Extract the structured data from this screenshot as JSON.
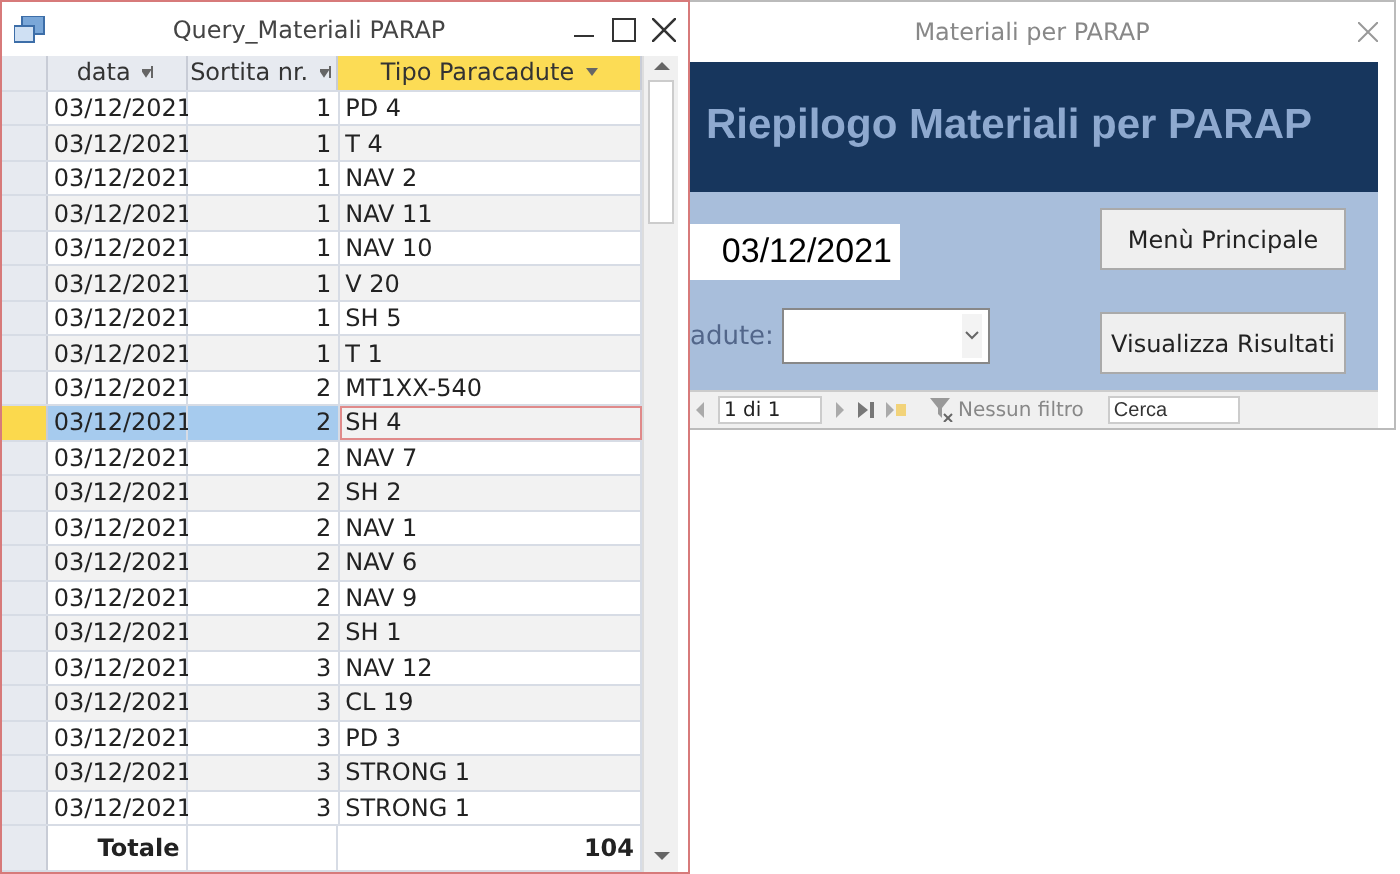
{
  "query_window": {
    "title": "Query_Materiali PARAP",
    "columns": [
      {
        "label": "data",
        "selected": false
      },
      {
        "label": "Sortita nr.",
        "selected": false
      },
      {
        "label": "Tipo Paracadute",
        "selected": true
      }
    ],
    "rows": [
      {
        "data": "03/12/2021",
        "sortita": "1",
        "tipo": "PD 4",
        "selected": false
      },
      {
        "data": "03/12/2021",
        "sortita": "1",
        "tipo": "T 4",
        "selected": false
      },
      {
        "data": "03/12/2021",
        "sortita": "1",
        "tipo": "NAV 2",
        "selected": false
      },
      {
        "data": "03/12/2021",
        "sortita": "1",
        "tipo": "NAV 11",
        "selected": false
      },
      {
        "data": "03/12/2021",
        "sortita": "1",
        "tipo": "NAV 10",
        "selected": false
      },
      {
        "data": "03/12/2021",
        "sortita": "1",
        "tipo": "V 20",
        "selected": false
      },
      {
        "data": "03/12/2021",
        "sortita": "1",
        "tipo": "SH 5",
        "selected": false
      },
      {
        "data": "03/12/2021",
        "sortita": "1",
        "tipo": "T 1",
        "selected": false
      },
      {
        "data": "03/12/2021",
        "sortita": "2",
        "tipo": "MT1XX-540",
        "selected": false
      },
      {
        "data": "03/12/2021",
        "sortita": "2",
        "tipo": "SH 4",
        "selected": true
      },
      {
        "data": "03/12/2021",
        "sortita": "2",
        "tipo": "NAV 7",
        "selected": false
      },
      {
        "data": "03/12/2021",
        "sortita": "2",
        "tipo": "SH 2",
        "selected": false
      },
      {
        "data": "03/12/2021",
        "sortita": "2",
        "tipo": "NAV 1",
        "selected": false
      },
      {
        "data": "03/12/2021",
        "sortita": "2",
        "tipo": "NAV 6",
        "selected": false
      },
      {
        "data": "03/12/2021",
        "sortita": "2",
        "tipo": "NAV 9",
        "selected": false
      },
      {
        "data": "03/12/2021",
        "sortita": "2",
        "tipo": "SH 1",
        "selected": false
      },
      {
        "data": "03/12/2021",
        "sortita": "3",
        "tipo": "NAV 12",
        "selected": false
      },
      {
        "data": "03/12/2021",
        "sortita": "3",
        "tipo": "CL 19",
        "selected": false
      },
      {
        "data": "03/12/2021",
        "sortita": "3",
        "tipo": "PD 3",
        "selected": false
      },
      {
        "data": "03/12/2021",
        "sortita": "3",
        "tipo": "STRONG 1",
        "selected": false
      },
      {
        "data": "03/12/2021",
        "sortita": "3",
        "tipo": "STRONG 1",
        "selected": false
      }
    ],
    "total": {
      "label": "Totale",
      "value": "104"
    }
  },
  "form_window": {
    "title": "Materiali per PARAP",
    "heading": "Riepilogo Materiali per PARAP",
    "date_value": "03/12/2021",
    "combo_label": "adute:",
    "buttons": [
      "Menù Principale",
      "Visualizza Risultati"
    ],
    "navigation": {
      "record": "1 di 1",
      "filter": "Nessun filtro",
      "search_placeholder": "Cerca"
    }
  }
}
